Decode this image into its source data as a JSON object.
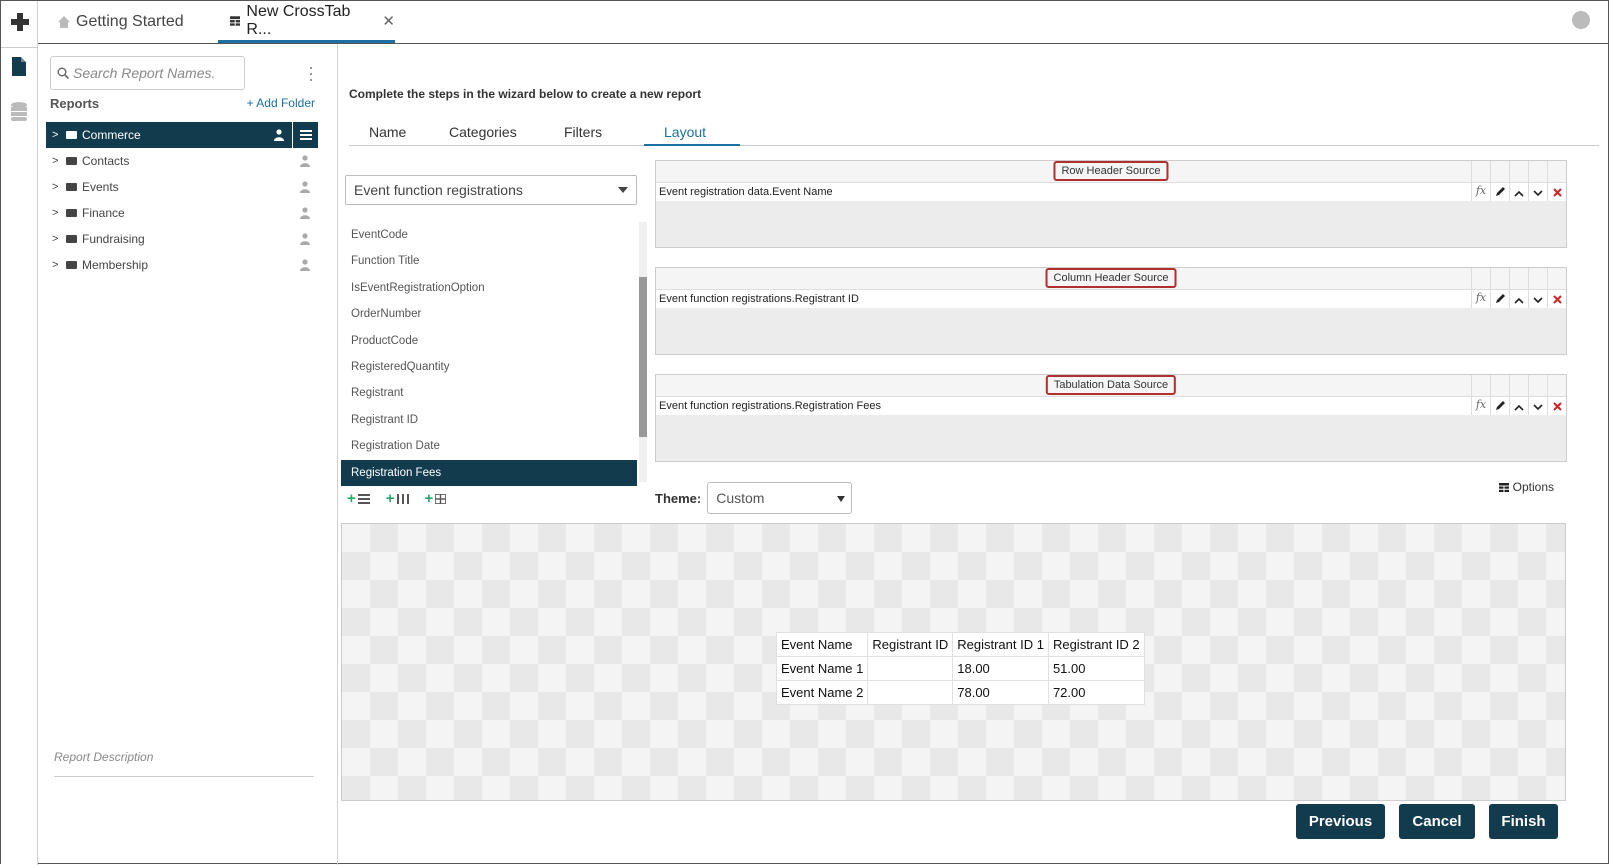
{
  "tabs": {
    "getting_started": "Getting Started",
    "crosstab": "New CrossTab R...",
    "close_glyph": "✕"
  },
  "sidebar": {
    "search_placeholder": "Search Report Names.",
    "reports_label": "Reports",
    "add_folder": "+ Add Folder",
    "items": [
      {
        "label": "Commerce",
        "selected": true
      },
      {
        "label": "Contacts"
      },
      {
        "label": "Events"
      },
      {
        "label": "Finance"
      },
      {
        "label": "Fundraising"
      },
      {
        "label": "Membership"
      }
    ],
    "report_description_placeholder": "Report Description"
  },
  "wizard": {
    "instruction": "Complete the steps in the wizard below to create a new report",
    "tabs": [
      "Name",
      "Categories",
      "Filters",
      "Layout"
    ],
    "active_tab": "Layout"
  },
  "layout": {
    "source": "Event function registrations",
    "fields": [
      "EventCode",
      "Function Title",
      "IsEventRegistrationOption",
      "OrderNumber",
      "ProductCode",
      "RegisteredQuantity",
      "Registrant",
      "Registrant ID",
      "Registration Date",
      "Registration Fees"
    ],
    "selected_field": "Registration Fees",
    "row_header": {
      "label": "Row Header Source",
      "value": "Event registration data.Event Name"
    },
    "column_header": {
      "label": "Column Header Source",
      "value": "Event function registrations.Registrant ID"
    },
    "tabulation": {
      "label": "Tabulation Data Source",
      "value": "Event function registrations.Registration Fees"
    },
    "fx_label": "fx",
    "theme_label": "Theme:",
    "theme_value": "Custom",
    "options_label": "Options"
  },
  "preview": {
    "headers": [
      "Event Name",
      "Registrant ID",
      "Registrant ID 1",
      "Registrant ID 2"
    ],
    "rows": [
      [
        "Event Name 1",
        "",
        "18.00",
        "51.00"
      ],
      [
        "Event Name 2",
        "",
        "78.00",
        "72.00"
      ]
    ]
  },
  "buttons": {
    "previous": "Previous",
    "cancel": "Cancel",
    "finish": "Finish"
  },
  "colors": {
    "primary_dark": "#123b4e",
    "accent_blue": "#1c6fa3",
    "highlight_red": "#b03030",
    "add_green": "#28a86b"
  }
}
